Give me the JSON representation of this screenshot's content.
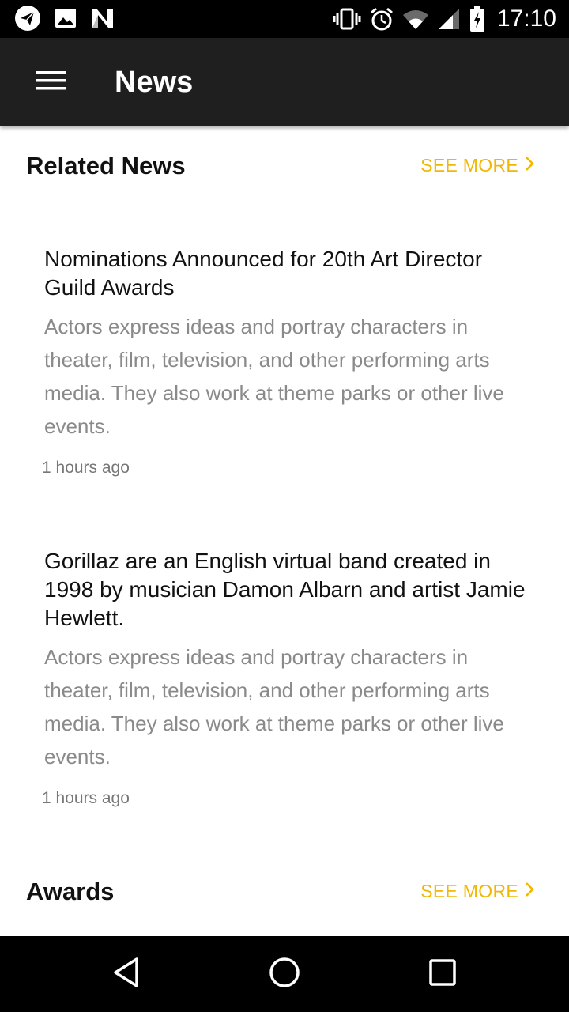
{
  "status_bar": {
    "time": "17:10",
    "left_icons": [
      "telegram-icon",
      "image-icon",
      "n-icon"
    ],
    "right_icons": [
      "vibrate-icon",
      "alarm-icon",
      "wifi-icon",
      "signal-icon",
      "battery-icon"
    ]
  },
  "app_bar": {
    "title": "News",
    "menu_icon": "hamburger-menu-icon"
  },
  "sections": [
    {
      "title": "Related News",
      "see_more": "SEE MORE",
      "items": [
        {
          "title": "Nominations Announced for 20th Art Director Guild Awards",
          "description": "Actors express ideas and portray characters in theater, film, television, and other performing arts media. They also work at theme parks or other live events.",
          "time": "1 hours ago"
        },
        {
          "title": "Gorillaz are an English virtual band created in 1998 by musician Damon Albarn and artist Jamie Hewlett.",
          "description": "Actors express ideas and portray characters in theater, film, television, and other performing arts media. They also work at theme parks or other live events.",
          "time": "1 hours ago"
        }
      ]
    },
    {
      "title": "Awards",
      "see_more": "SEE MORE",
      "items": []
    }
  ],
  "colors": {
    "accent": "#f2b705",
    "app_bar": "#1f1f1f",
    "status_bar": "#000000",
    "title_text": "#111111",
    "body_text": "#8a8a8a"
  },
  "nav_bar": {
    "buttons": [
      "back-icon",
      "home-icon",
      "recents-icon"
    ]
  }
}
